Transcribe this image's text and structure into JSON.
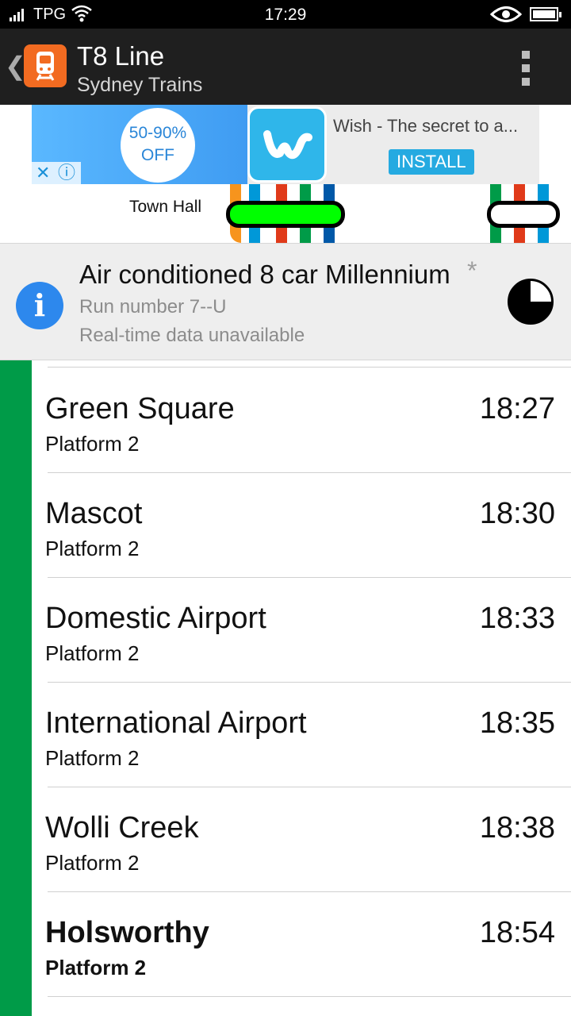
{
  "status_bar": {
    "carrier": "TPG",
    "time": "17:29"
  },
  "app_bar": {
    "title": "T8 Line",
    "subtitle": "Sydney Trains"
  },
  "ad": {
    "promo_line1": "50-90%",
    "promo_line2": "OFF",
    "title": "Wish - The secret to a...",
    "install_label": "INSTALL",
    "close_glyph": "✕",
    "info_glyph": "ⓘ"
  },
  "map": {
    "station": "Town Hall",
    "colors": {
      "green": "#00ff00",
      "orange": "#f7941d",
      "blue": "#0098d8",
      "red": "#e03a1a",
      "dark_green": "#009b48",
      "navy": "#0058a8"
    }
  },
  "train_info": {
    "title": "Air conditioned 8 car Millennium",
    "asterisk": "*",
    "run_number": "Run number 7--U",
    "realtime": "Real-time data unavailable"
  },
  "line_color": "#009b48",
  "stops": [
    {
      "name": "Green Square",
      "platform": "Platform 2",
      "time": "18:27"
    },
    {
      "name": "Mascot",
      "platform": "Platform 2",
      "time": "18:30"
    },
    {
      "name": "Domestic Airport",
      "platform": "Platform 2",
      "time": "18:33"
    },
    {
      "name": "International Airport",
      "platform": "Platform 2",
      "time": "18:35"
    },
    {
      "name": "Wolli Creek",
      "platform": "Platform 2",
      "time": "18:38"
    },
    {
      "name": "Holsworthy",
      "platform": "Platform 2",
      "time": "18:54"
    }
  ]
}
